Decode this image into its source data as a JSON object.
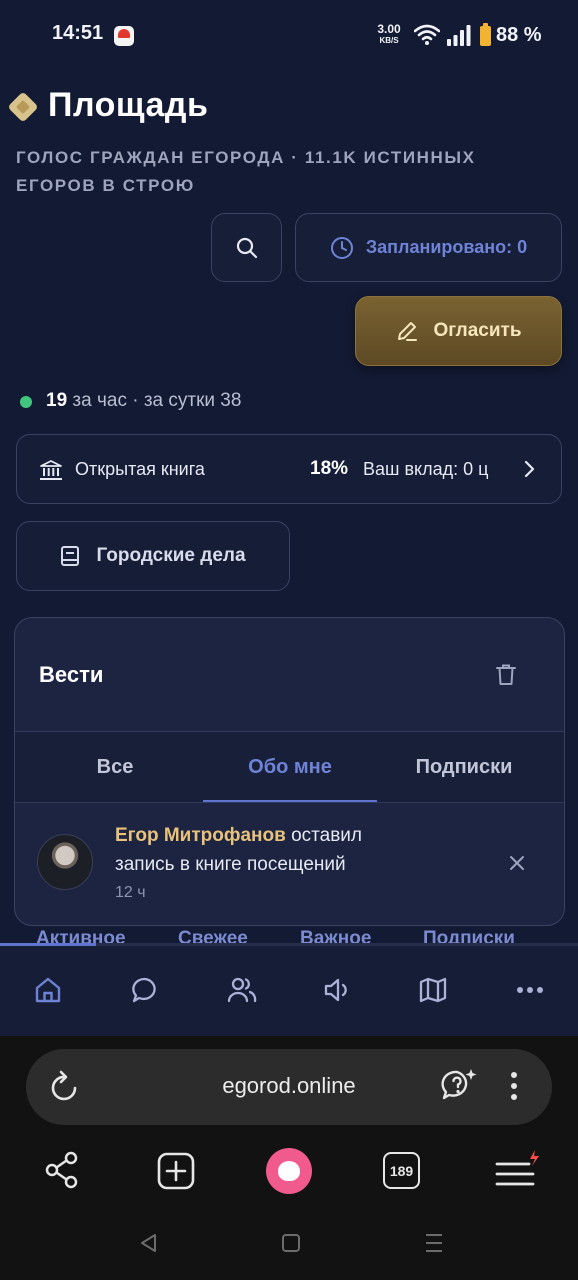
{
  "status_bar": {
    "time": "14:51",
    "net_speed": "3.00",
    "net_unit": "KB/S",
    "battery": "88 %",
    "icons": [
      "app-notification-icon",
      "wifi-icon",
      "signal-icon",
      "battery-icon"
    ]
  },
  "header": {
    "title": "Площадь",
    "subtitle": "Голос граждан Егорода · 11.1K истинных Егоров в строю"
  },
  "actions": {
    "scheduled_label": "Запланировано: 0",
    "announce_label": "Огласить"
  },
  "activity": {
    "count": "19",
    "rest": " за час · за сутки 38"
  },
  "book": {
    "label": "Открытая книга",
    "percent": "18%",
    "contribution": "Ваш вклад: 0 ц"
  },
  "city_affairs_label": "Городские дела",
  "feed_tabs": [
    "Активное",
    "Свежее",
    "Важное",
    "Подписки"
  ],
  "notifications": {
    "title": "Вести",
    "tabs": [
      "Все",
      "Обо мне",
      "Подписки"
    ],
    "active_tab": 1,
    "items": [
      {
        "author": "Егор Митрофанов",
        "text": " оставил запись в книге посещений",
        "time": "12 ч"
      }
    ]
  },
  "app_nav": [
    "home-icon",
    "chat-icon",
    "people-icon",
    "megaphone-icon",
    "map-icon",
    "more-icon"
  ],
  "browser": {
    "url": "egorod.online",
    "tabs_count": "189"
  },
  "colors": {
    "background": "#131a33",
    "accent": "#6f83d6",
    "gold": "#e8c27a",
    "online": "#41c67e"
  }
}
